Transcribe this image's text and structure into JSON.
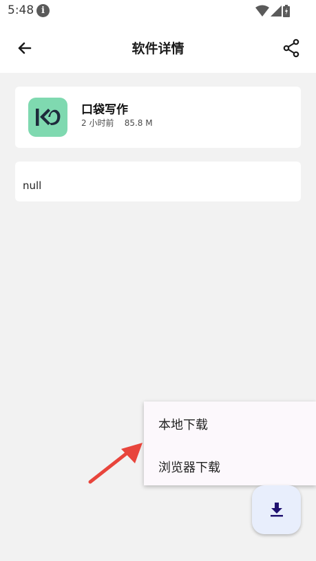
{
  "status_bar": {
    "time": "5:48"
  },
  "app_bar": {
    "title": "软件详情"
  },
  "app_card": {
    "name": "口袋写作",
    "meta": "2 小时前    85.8 M"
  },
  "description": {
    "text": "null"
  },
  "download_menu": {
    "items": [
      {
        "label": "本地下载"
      },
      {
        "label": "浏览器下载"
      }
    ]
  },
  "colors": {
    "background": "#f2f2f2",
    "card": "#ffffff",
    "app_icon_bg": "#7fd9b0",
    "fab_bg": "#e8eefc",
    "fab_icon": "#1f1170",
    "arrow": "#e8453c"
  },
  "icons": {
    "back": "arrow-left-icon",
    "share": "share-icon",
    "fab": "download-icon"
  }
}
